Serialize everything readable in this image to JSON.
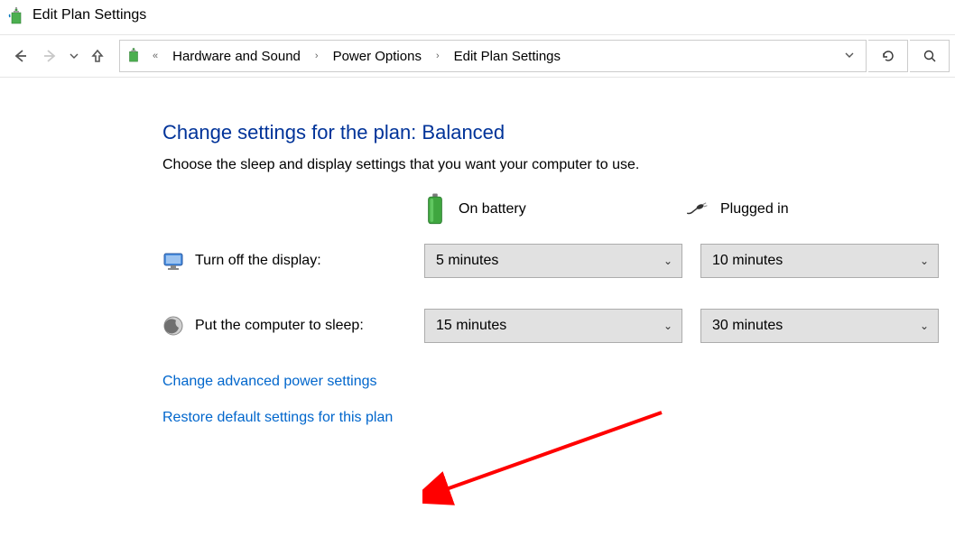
{
  "titlebar": {
    "title": "Edit Plan Settings"
  },
  "breadcrumb": {
    "item1": "Hardware and Sound",
    "item2": "Power Options",
    "item3": "Edit Plan Settings"
  },
  "content": {
    "heading": "Change settings for the plan: Balanced",
    "subtext": "Choose the sleep and display settings that you want your computer to use.",
    "mode_battery": "On battery",
    "mode_plugged": "Plugged in",
    "row_display_label": "Turn off the display:",
    "row_sleep_label": "Put the computer to sleep:",
    "display_battery": "5 minutes",
    "display_plugged": "10 minutes",
    "sleep_battery": "15 minutes",
    "sleep_plugged": "30 minutes",
    "link_advanced": "Change advanced power settings",
    "link_restore": "Restore default settings for this plan"
  }
}
